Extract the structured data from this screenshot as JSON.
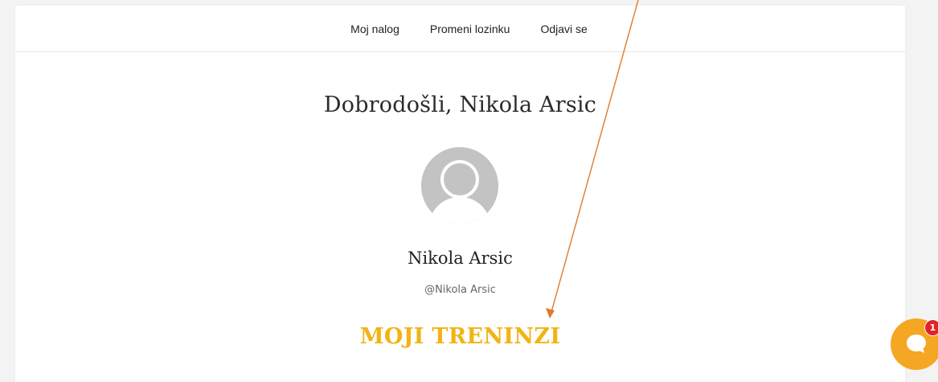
{
  "nav": {
    "items": [
      {
        "label": "Moj nalog"
      },
      {
        "label": "Promeni lozinku"
      },
      {
        "label": "Odjavi se"
      }
    ]
  },
  "profile": {
    "welcome": "Dobrodošli, Nikola Arsic",
    "name": "Nikola Arsic",
    "handle": "@Nikola Arsic",
    "avatar_icon": "default-user-avatar-icon"
  },
  "section": {
    "heading": "MOJI TRENINZI"
  },
  "chat": {
    "badge_count": "1",
    "icon": "chat-bubble-icon"
  },
  "colors": {
    "accent": "#f2b414",
    "chat_button": "#f5a623",
    "badge": "#e0242a",
    "annotation_arrow": "#e07a2c"
  }
}
